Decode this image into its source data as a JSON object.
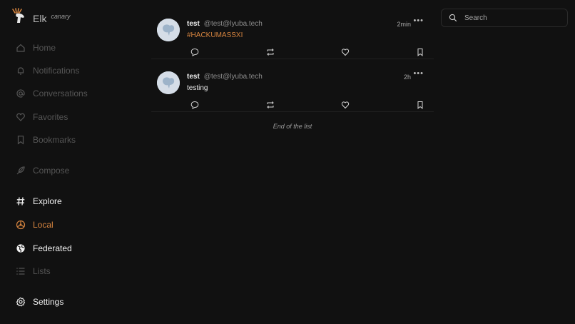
{
  "app": {
    "name": "Elk",
    "badge": "canary"
  },
  "sidebar": {
    "items": [
      {
        "label": "Home",
        "icon": "home-icon",
        "state": "dim"
      },
      {
        "label": "Notifications",
        "icon": "bell-icon",
        "state": "dim"
      },
      {
        "label": "Conversations",
        "icon": "at-icon",
        "state": "dim"
      },
      {
        "label": "Favorites",
        "icon": "heart-icon",
        "state": "dim"
      },
      {
        "label": "Bookmarks",
        "icon": "bookmark-icon",
        "state": "dim"
      },
      {
        "label": "Compose",
        "icon": "feather-icon",
        "state": "dim"
      },
      {
        "label": "Explore",
        "icon": "hashtag-icon",
        "state": "bright"
      },
      {
        "label": "Local",
        "icon": "local-icon",
        "state": "accent"
      },
      {
        "label": "Federated",
        "icon": "globe-icon",
        "state": "bright"
      },
      {
        "label": "Lists",
        "icon": "list-icon",
        "state": "dim"
      },
      {
        "label": "Settings",
        "icon": "gear-icon",
        "state": "bright"
      }
    ]
  },
  "timeline": {
    "posts": [
      {
        "display_name": "test",
        "handle": "@test@lyuba.tech",
        "time": "2min",
        "content": "#HACKUMASSXI",
        "content_is_tag": true
      },
      {
        "display_name": "test",
        "handle": "@test@lyuba.tech",
        "time": "2h",
        "content": "testing",
        "content_is_tag": false
      }
    ],
    "end_text": "End of the list"
  },
  "search": {
    "placeholder": "Search"
  },
  "colors": {
    "background": "#111111",
    "accent": "#d6843f",
    "dim": "#555555",
    "text": "#f2f2f2"
  }
}
